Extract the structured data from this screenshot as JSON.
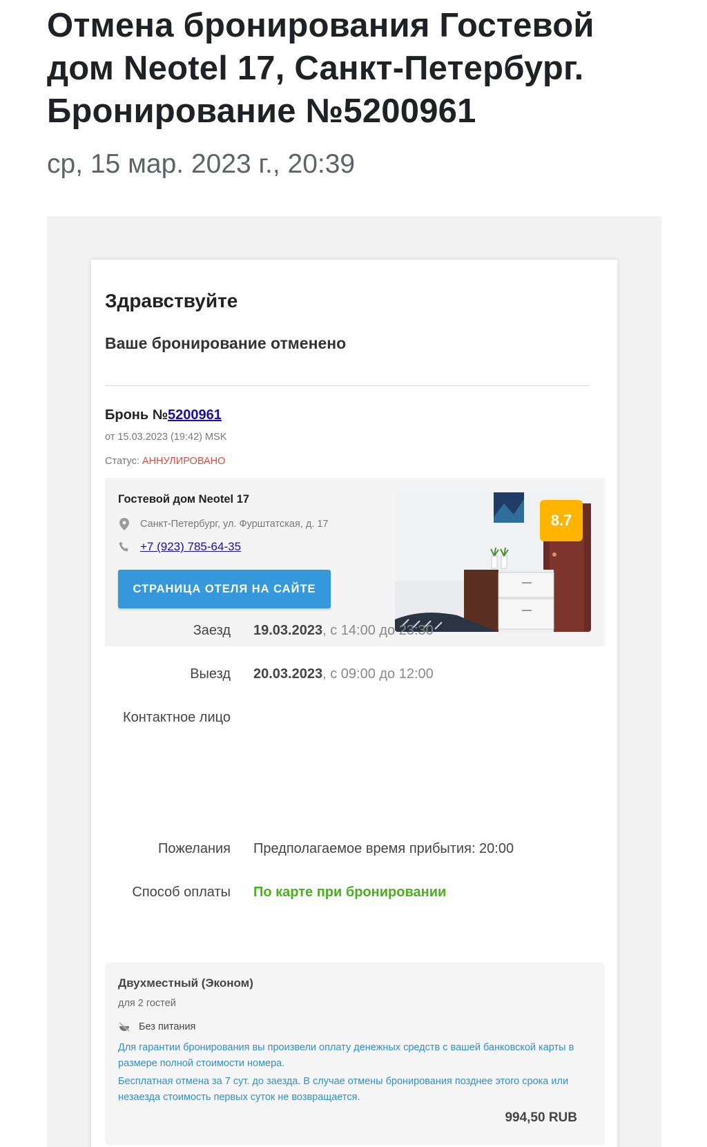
{
  "email": {
    "subject": "Отмена бронирования Гостевой дом Neotel 17, Санкт-Петербург. Бронирование №5200961",
    "date": "ср, 15 мар. 2023 г., 20:39"
  },
  "card": {
    "greeting": "Здравствуйте",
    "message": "Ваше бронирование отменено",
    "booking_prefix": "Бронь №",
    "booking_number": "5200961",
    "booking_date": "от 15.03.2023 (19:42) MSK",
    "status_label": "Статус: ",
    "status_value": "АННУЛИРОВАНО"
  },
  "hotel": {
    "name": "Гостевой дом  Neotel 17",
    "address": "Санкт-Петербург, ул. Фурштатская, д. 17",
    "phone": "+7 (923) 785-64-35",
    "site_button": "СТРАНИЦА ОТЕЛЯ НА САЙТЕ",
    "rating": "8.7"
  },
  "details": {
    "checkin_label": "Заезд",
    "checkin_date": "19.03.2023",
    "checkin_time": ", с 14:00 до 23:30",
    "checkout_label": "Выезд",
    "checkout_date": "20.03.2023",
    "checkout_time": ", с 09:00 до 12:00",
    "contact_label": "Контактное лицо",
    "wishes_label": "Пожелания",
    "wishes_value": "Предполагаемое время прибытия: 20:00",
    "payment_label": "Способ оплаты",
    "payment_value": "По карте при бронировании"
  },
  "room": {
    "title": "Двухместный (Эконом)",
    "guests": "для 2 гостей",
    "meal": "Без питания",
    "note1": "Для гарантии бронирования вы произвели оплату денежных средств с вашей банковской карты в размере полной стоимости номера.",
    "note2": "Бесплатная отмена за 7 сут. до заезда. В случае отмены бронирования позднее этого срока или незаезда стоимость первых суток не возвращается.",
    "price": "994,50 RUB"
  },
  "colors": {
    "button": "#3498db",
    "status": "#e04a3c",
    "payment": "#4caf1f",
    "link": "#1a0dab",
    "rating_badge": "#ffb400",
    "note_text": "#2f8fcf"
  },
  "icons": [
    "location-pin-icon",
    "phone-icon",
    "no-meal-icon"
  ]
}
